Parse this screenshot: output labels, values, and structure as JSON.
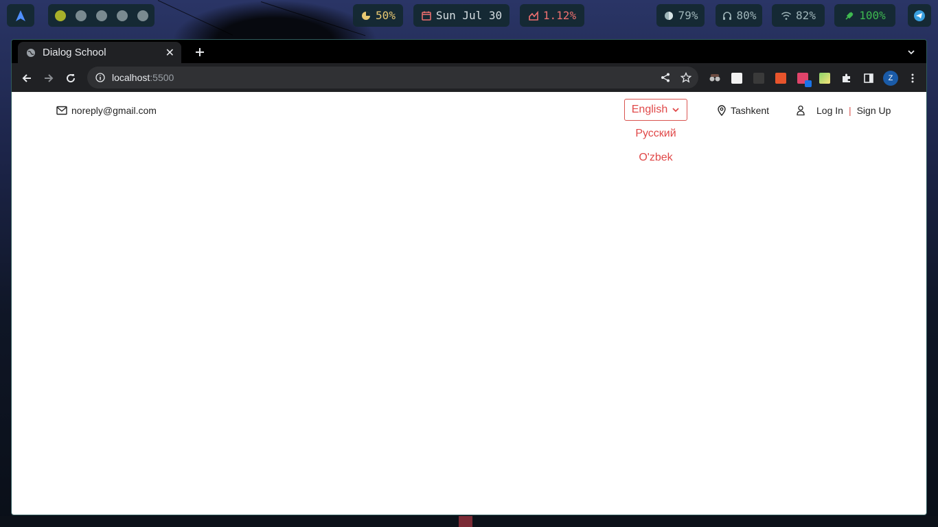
{
  "topbar": {
    "workspaces": [
      {
        "active": true
      },
      {
        "active": false
      },
      {
        "active": false
      },
      {
        "active": false
      },
      {
        "active": false
      }
    ],
    "cpu": "50%",
    "date": "Sun Jul 30",
    "net_rate": "1.12%",
    "brightness": "79%",
    "volume": "80%",
    "wifi": "82%",
    "battery": "100%",
    "colors": {
      "cpu": "#e8c872",
      "date": "#d7dfe3",
      "net_rate": "#f07070",
      "brightness": "#9fb5b9",
      "volume": "#9fb5b9",
      "wifi": "#9fb5b9",
      "battery": "#3fb950"
    }
  },
  "browser": {
    "tab_title": "Dialog School",
    "url_host": "localhost",
    "url_port": ":5500",
    "profile_initial": "Z"
  },
  "page": {
    "email": "noreply@gmail.com",
    "language_selected": "English",
    "language_options": [
      "Русский",
      "O'zbek"
    ],
    "location": "Tashkent",
    "login_label": "Log In",
    "separator": "|",
    "signup_label": "Sign Up",
    "accent_color": "#e04848"
  }
}
